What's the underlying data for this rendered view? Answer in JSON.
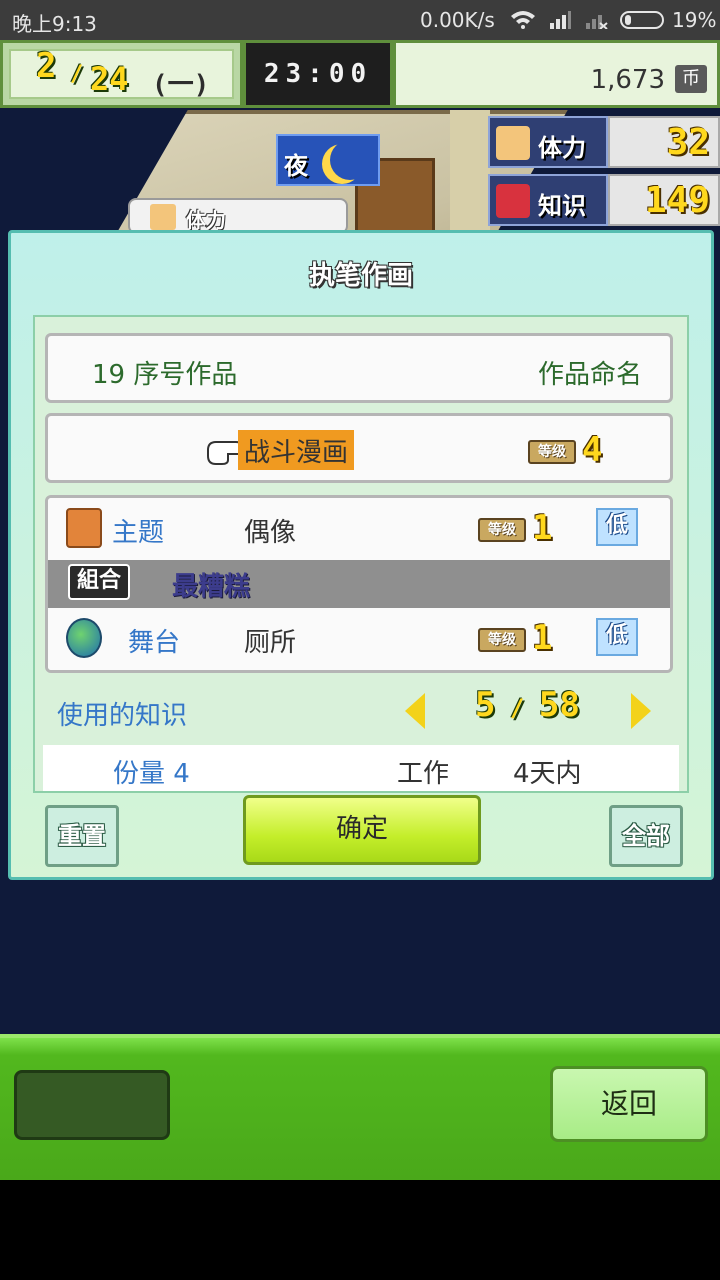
{
  "status_bar": {
    "time": "晚上9:13",
    "net_speed": "0.00K/s",
    "battery": "19%"
  },
  "hud": {
    "month": "2",
    "day": "24",
    "weekday": "(一)",
    "clock": "23:00",
    "money": "1,673",
    "currency_icon": "币",
    "stamina_label": "体力",
    "stamina_value": "32",
    "knowledge_label": "知识",
    "knowledge_value": "149",
    "night_label": "夜",
    "bubble_label": "体力"
  },
  "dialog": {
    "title": "执笔作画",
    "work_number": "19 序号作品",
    "rename_label": "作品命名",
    "genre": "战斗漫画",
    "genre_level_tag": "等级",
    "genre_level": "4",
    "theme": {
      "category": "主题",
      "value": "偶像",
      "level_tag": "等级",
      "level": "1",
      "grade": "低"
    },
    "combo": {
      "label": "組合",
      "rating": "最糟糕"
    },
    "stage": {
      "category": "舞台",
      "value": "厕所",
      "level_tag": "等级",
      "level": "1",
      "grade": "低"
    },
    "knowledge_used_label": "使用的知识",
    "knowledge_used": "5",
    "knowledge_total": "58",
    "volume": "份量 4",
    "work_label": "工作",
    "work_days": "4天内",
    "reset_button": "重置",
    "confirm_button": "确定",
    "all_button": "全部"
  },
  "bottom": {
    "back_button": "返回"
  },
  "colors": {
    "accent_green": "#a8d918",
    "dialog_bg": "#bff0ea",
    "gold_numbers": "#ffd81e",
    "highlight": "#f09a20"
  }
}
